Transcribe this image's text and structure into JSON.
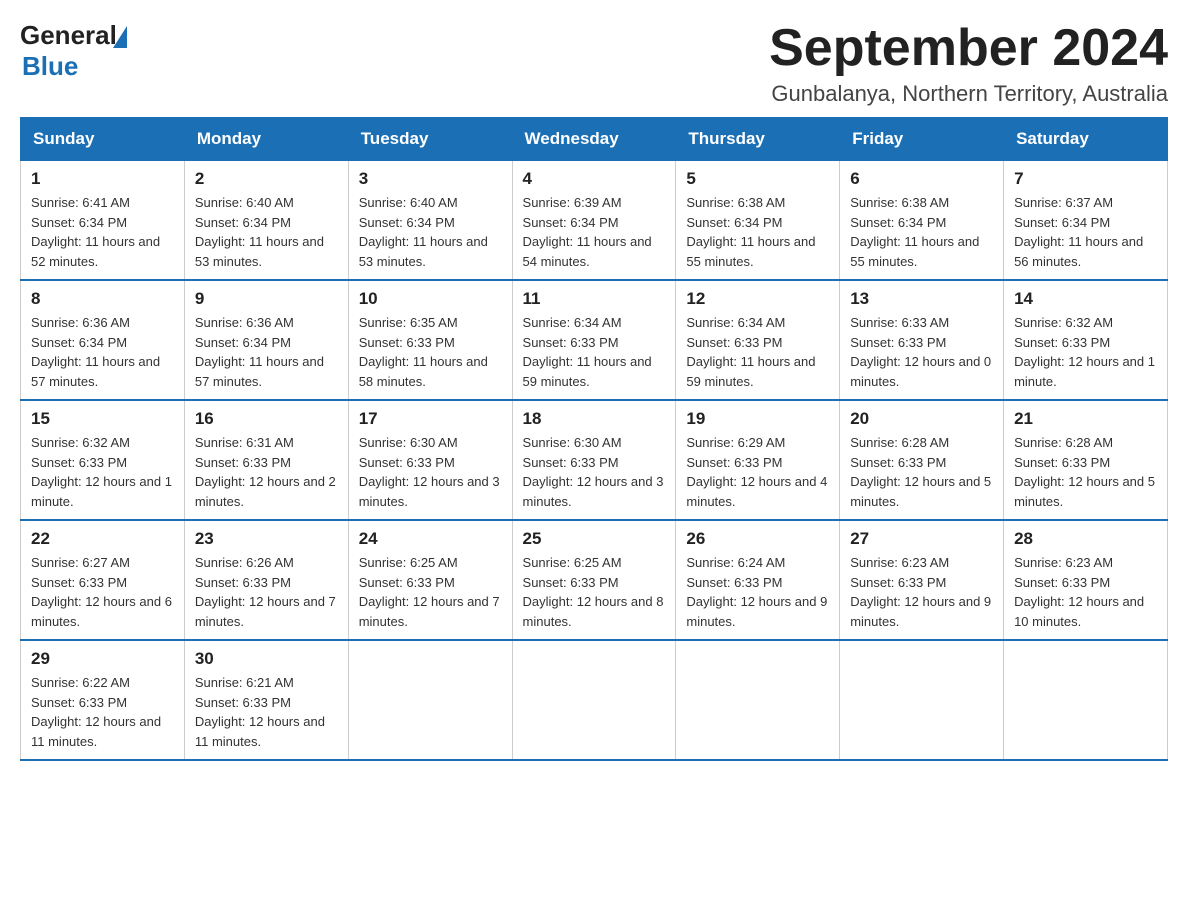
{
  "logo": {
    "general": "General",
    "blue": "Blue"
  },
  "title": "September 2024",
  "location": "Gunbalanya, Northern Territory, Australia",
  "days_of_week": [
    "Sunday",
    "Monday",
    "Tuesday",
    "Wednesday",
    "Thursday",
    "Friday",
    "Saturday"
  ],
  "weeks": [
    [
      {
        "day": "1",
        "sunrise": "6:41 AM",
        "sunset": "6:34 PM",
        "daylight": "11 hours and 52 minutes."
      },
      {
        "day": "2",
        "sunrise": "6:40 AM",
        "sunset": "6:34 PM",
        "daylight": "11 hours and 53 minutes."
      },
      {
        "day": "3",
        "sunrise": "6:40 AM",
        "sunset": "6:34 PM",
        "daylight": "11 hours and 53 minutes."
      },
      {
        "day": "4",
        "sunrise": "6:39 AM",
        "sunset": "6:34 PM",
        "daylight": "11 hours and 54 minutes."
      },
      {
        "day": "5",
        "sunrise": "6:38 AM",
        "sunset": "6:34 PM",
        "daylight": "11 hours and 55 minutes."
      },
      {
        "day": "6",
        "sunrise": "6:38 AM",
        "sunset": "6:34 PM",
        "daylight": "11 hours and 55 minutes."
      },
      {
        "day": "7",
        "sunrise": "6:37 AM",
        "sunset": "6:34 PM",
        "daylight": "11 hours and 56 minutes."
      }
    ],
    [
      {
        "day": "8",
        "sunrise": "6:36 AM",
        "sunset": "6:34 PM",
        "daylight": "11 hours and 57 minutes."
      },
      {
        "day": "9",
        "sunrise": "6:36 AM",
        "sunset": "6:34 PM",
        "daylight": "11 hours and 57 minutes."
      },
      {
        "day": "10",
        "sunrise": "6:35 AM",
        "sunset": "6:33 PM",
        "daylight": "11 hours and 58 minutes."
      },
      {
        "day": "11",
        "sunrise": "6:34 AM",
        "sunset": "6:33 PM",
        "daylight": "11 hours and 59 minutes."
      },
      {
        "day": "12",
        "sunrise": "6:34 AM",
        "sunset": "6:33 PM",
        "daylight": "11 hours and 59 minutes."
      },
      {
        "day": "13",
        "sunrise": "6:33 AM",
        "sunset": "6:33 PM",
        "daylight": "12 hours and 0 minutes."
      },
      {
        "day": "14",
        "sunrise": "6:32 AM",
        "sunset": "6:33 PM",
        "daylight": "12 hours and 1 minute."
      }
    ],
    [
      {
        "day": "15",
        "sunrise": "6:32 AM",
        "sunset": "6:33 PM",
        "daylight": "12 hours and 1 minute."
      },
      {
        "day": "16",
        "sunrise": "6:31 AM",
        "sunset": "6:33 PM",
        "daylight": "12 hours and 2 minutes."
      },
      {
        "day": "17",
        "sunrise": "6:30 AM",
        "sunset": "6:33 PM",
        "daylight": "12 hours and 3 minutes."
      },
      {
        "day": "18",
        "sunrise": "6:30 AM",
        "sunset": "6:33 PM",
        "daylight": "12 hours and 3 minutes."
      },
      {
        "day": "19",
        "sunrise": "6:29 AM",
        "sunset": "6:33 PM",
        "daylight": "12 hours and 4 minutes."
      },
      {
        "day": "20",
        "sunrise": "6:28 AM",
        "sunset": "6:33 PM",
        "daylight": "12 hours and 5 minutes."
      },
      {
        "day": "21",
        "sunrise": "6:28 AM",
        "sunset": "6:33 PM",
        "daylight": "12 hours and 5 minutes."
      }
    ],
    [
      {
        "day": "22",
        "sunrise": "6:27 AM",
        "sunset": "6:33 PM",
        "daylight": "12 hours and 6 minutes."
      },
      {
        "day": "23",
        "sunrise": "6:26 AM",
        "sunset": "6:33 PM",
        "daylight": "12 hours and 7 minutes."
      },
      {
        "day": "24",
        "sunrise": "6:25 AM",
        "sunset": "6:33 PM",
        "daylight": "12 hours and 7 minutes."
      },
      {
        "day": "25",
        "sunrise": "6:25 AM",
        "sunset": "6:33 PM",
        "daylight": "12 hours and 8 minutes."
      },
      {
        "day": "26",
        "sunrise": "6:24 AM",
        "sunset": "6:33 PM",
        "daylight": "12 hours and 9 minutes."
      },
      {
        "day": "27",
        "sunrise": "6:23 AM",
        "sunset": "6:33 PM",
        "daylight": "12 hours and 9 minutes."
      },
      {
        "day": "28",
        "sunrise": "6:23 AM",
        "sunset": "6:33 PM",
        "daylight": "12 hours and 10 minutes."
      }
    ],
    [
      {
        "day": "29",
        "sunrise": "6:22 AM",
        "sunset": "6:33 PM",
        "daylight": "12 hours and 11 minutes."
      },
      {
        "day": "30",
        "sunrise": "6:21 AM",
        "sunset": "6:33 PM",
        "daylight": "12 hours and 11 minutes."
      },
      null,
      null,
      null,
      null,
      null
    ]
  ],
  "labels": {
    "sunrise": "Sunrise:",
    "sunset": "Sunset:",
    "daylight": "Daylight:"
  }
}
